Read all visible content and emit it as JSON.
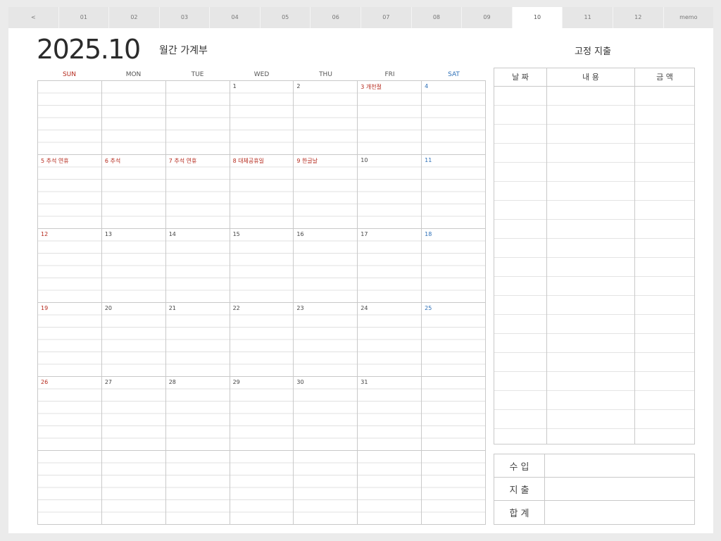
{
  "tabs": [
    {
      "label": "<",
      "active": false
    },
    {
      "label": "01",
      "active": false
    },
    {
      "label": "02",
      "active": false
    },
    {
      "label": "03",
      "active": false
    },
    {
      "label": "04",
      "active": false
    },
    {
      "label": "05",
      "active": false
    },
    {
      "label": "06",
      "active": false
    },
    {
      "label": "07",
      "active": false
    },
    {
      "label": "08",
      "active": false
    },
    {
      "label": "09",
      "active": false
    },
    {
      "label": "10",
      "active": true
    },
    {
      "label": "11",
      "active": false
    },
    {
      "label": "12",
      "active": false
    },
    {
      "label": "memo",
      "active": false
    }
  ],
  "header": {
    "year_month": "2025.10",
    "subtitle": "월간 가계부",
    "fixed_title": "고정 지출"
  },
  "weekdays": [
    "SUN",
    "MON",
    "TUE",
    "WED",
    "THU",
    "FRI",
    "SAT"
  ],
  "calendar_cells": [
    {
      "label": "",
      "color": ""
    },
    {
      "label": "",
      "color": ""
    },
    {
      "label": "",
      "color": ""
    },
    {
      "label": "1",
      "color": ""
    },
    {
      "label": "2",
      "color": ""
    },
    {
      "label": "3 개천절",
      "color": "red"
    },
    {
      "label": "4",
      "color": "blue"
    },
    {
      "label": "5 추석 연휴",
      "color": "red"
    },
    {
      "label": "6 추석",
      "color": "red"
    },
    {
      "label": "7 추석 연휴",
      "color": "red"
    },
    {
      "label": "8 대체공휴일",
      "color": "red"
    },
    {
      "label": "9 한글날",
      "color": "red"
    },
    {
      "label": "10",
      "color": ""
    },
    {
      "label": "11",
      "color": "blue"
    },
    {
      "label": "12",
      "color": "red"
    },
    {
      "label": "13",
      "color": ""
    },
    {
      "label": "14",
      "color": ""
    },
    {
      "label": "15",
      "color": ""
    },
    {
      "label": "16",
      "color": ""
    },
    {
      "label": "17",
      "color": ""
    },
    {
      "label": "18",
      "color": "blue"
    },
    {
      "label": "19",
      "color": "red"
    },
    {
      "label": "20",
      "color": ""
    },
    {
      "label": "21",
      "color": ""
    },
    {
      "label": "22",
      "color": ""
    },
    {
      "label": "23",
      "color": ""
    },
    {
      "label": "24",
      "color": ""
    },
    {
      "label": "25",
      "color": "blue"
    },
    {
      "label": "26",
      "color": "red"
    },
    {
      "label": "27",
      "color": ""
    },
    {
      "label": "28",
      "color": ""
    },
    {
      "label": "29",
      "color": ""
    },
    {
      "label": "30",
      "color": ""
    },
    {
      "label": "31",
      "color": ""
    },
    {
      "label": "",
      "color": ""
    },
    {
      "label": "",
      "color": ""
    },
    {
      "label": "",
      "color": ""
    },
    {
      "label": "",
      "color": ""
    },
    {
      "label": "",
      "color": ""
    },
    {
      "label": "",
      "color": ""
    },
    {
      "label": "",
      "color": ""
    },
    {
      "label": "",
      "color": ""
    }
  ],
  "fixed_expense": {
    "col_date": "날 짜",
    "col_content": "내 용",
    "col_amount": "금 액"
  },
  "summary": {
    "income": "수 입",
    "expense": "지 출",
    "total": "합 계"
  },
  "colors": {
    "sunday": "#b52a1d",
    "saturday": "#2c6fb7",
    "grid": "#c9c9c9",
    "background": "#ebebeb",
    "sheet": "#ffffff"
  }
}
